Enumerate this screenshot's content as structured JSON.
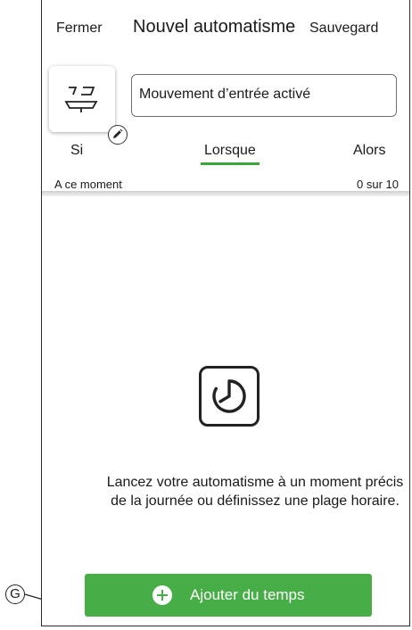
{
  "header": {
    "close_label": "Fermer",
    "title": "Nouvel automatisme",
    "save_label": "Sauvegard"
  },
  "automation": {
    "name": "Mouvement d’entrée activé",
    "icon": "motion-sensor-icon"
  },
  "tabs": [
    {
      "label": "Si",
      "active": false
    },
    {
      "label": "Lorsque",
      "active": true
    },
    {
      "label": "Alors",
      "active": false
    }
  ],
  "subheader": {
    "left": "A ce moment",
    "right": "0 sur 10"
  },
  "empty_state": {
    "icon": "clock-icon",
    "description": "Lancez votre automatisme à un moment précis de la journée ou définissez une plage horaire."
  },
  "add_button": {
    "label": "Ajouter du temps",
    "icon": "plus-circle-icon"
  },
  "callout": {
    "label": "G"
  },
  "colors": {
    "accent": "#47ae47",
    "tab_underline": "#3aa63a",
    "border": "#2b2b2b"
  }
}
